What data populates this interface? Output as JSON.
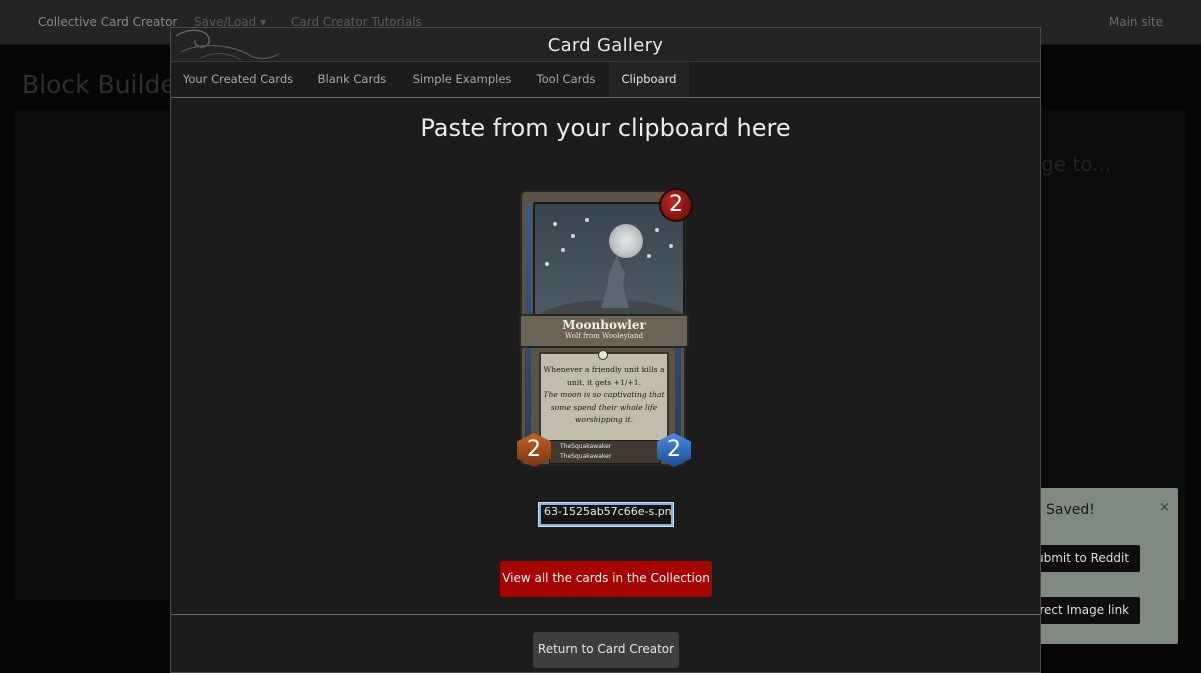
{
  "topnav": {
    "brand": "Collective Card Creator",
    "save_load": "Save/Load ▾",
    "tutorials": "Card Creator Tutorials",
    "main_site": "Main site"
  },
  "background": {
    "page_title": "Block Builde",
    "side_text": "ge to..."
  },
  "toast": {
    "title": "Saved!",
    "close": "×",
    "submit_label": "ubmit to Reddit",
    "direct_link_label": "irect Image link"
  },
  "modal": {
    "title": "Card Gallery",
    "tabs": [
      {
        "label": "Your Created Cards"
      },
      {
        "label": "Blank Cards"
      },
      {
        "label": "Simple Examples"
      },
      {
        "label": "Tool Cards"
      },
      {
        "label": "Clipboard",
        "active": true
      }
    ],
    "paste_heading": "Paste from your clipboard here",
    "url_value": "63-1525ab57c66e-s.png",
    "view_collection_label": "View all the cards in the Collection",
    "return_label": "Return to Card Creator"
  },
  "card": {
    "name": "Moonhowler",
    "type": "Wolf from Wooleyland",
    "rules": "Whenever a friendly unit kills a unit, it gets +1/+1.",
    "flavor": "The moon is so captivating that some spend their whole life worshipping it.",
    "artist": "TheSquakawaker",
    "author": "TheSquakawaker",
    "cost": "2",
    "attack": "2",
    "health": "2"
  },
  "colors": {
    "primary_button": "#a50404",
    "input_focus": "#8ab0e0",
    "toast_bg": "#808a80"
  }
}
